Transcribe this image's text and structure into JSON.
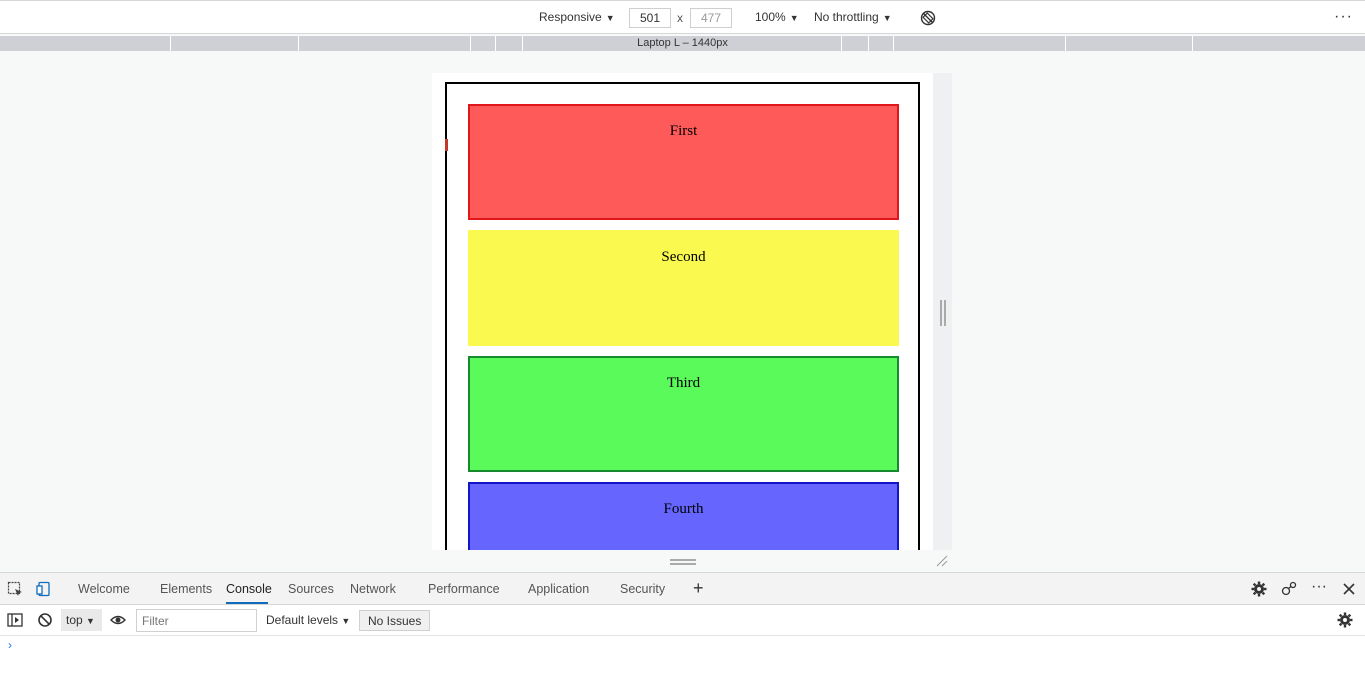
{
  "device_toolbar": {
    "device": "Responsive",
    "width": "501",
    "height": "477",
    "zoom": "100%",
    "throttling": "No throttling",
    "caret": "▼",
    "times": "x"
  },
  "media_query_bar": {
    "label": "Laptop L – 1440px"
  },
  "page": {
    "panels": [
      {
        "label": "First",
        "bg": "#ff5a5a",
        "border": "#e0161b"
      },
      {
        "label": "Second",
        "bg": "#f9f950",
        "border": "#f9f950"
      },
      {
        "label": "Third",
        "bg": "#5afa5a",
        "border": "#168a2c"
      },
      {
        "label": "Fourth",
        "bg": "#6666ff",
        "border": "#1414c8"
      }
    ]
  },
  "devtools": {
    "tabs": [
      "Welcome",
      "Elements",
      "Console",
      "Sources",
      "Network",
      "Performance",
      "Application",
      "Security"
    ],
    "active_tab": "Console",
    "add_tab": "+",
    "accent": "#0f6cbd"
  },
  "console": {
    "context": "top",
    "filter_placeholder": "Filter",
    "levels": "Default levels",
    "issues": "No Issues",
    "prompt": "›"
  }
}
